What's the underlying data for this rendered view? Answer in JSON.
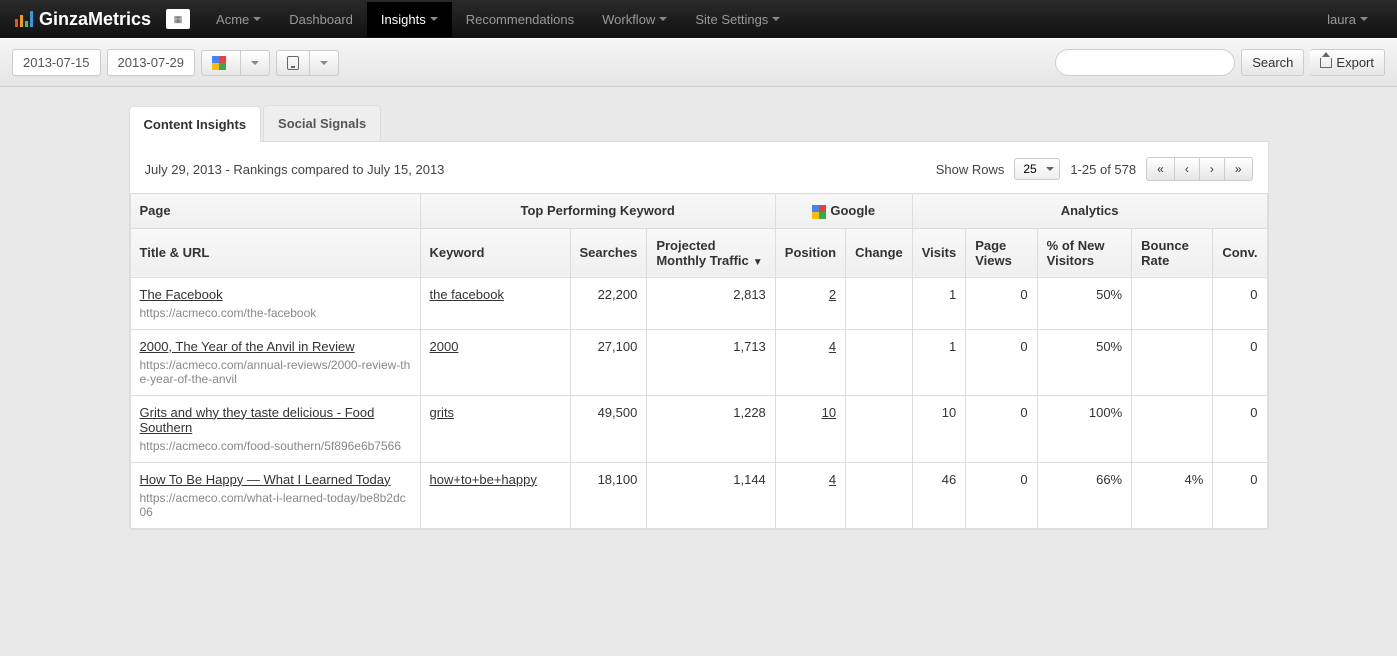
{
  "navbar": {
    "brand": "GinzaMetrics",
    "account": "Acme",
    "items": [
      "Dashboard",
      "Insights",
      "Recommendations",
      "Workflow",
      "Site Settings"
    ],
    "active_index": 1,
    "user": "laura"
  },
  "toolbar": {
    "date_start": "2013-07-15",
    "date_end": "2013-07-29",
    "search_label": "Search",
    "export_label": "Export"
  },
  "tabs": {
    "items": [
      "Content Insights",
      "Social Signals"
    ],
    "active_index": 0
  },
  "panel": {
    "summary": "July 29, 2013 - Rankings compared to July 15, 2013",
    "show_rows_label": "Show Rows",
    "show_rows_value": "25",
    "range_text": "1-25 of 578",
    "pager": {
      "first": "«",
      "prev": "‹",
      "next": "›",
      "last": "»"
    }
  },
  "table": {
    "group_headers": {
      "page": "Page",
      "keyword": "Top Performing Keyword",
      "google": "Google",
      "analytics": "Analytics"
    },
    "headers": {
      "title_url": "Title & URL",
      "keyword": "Keyword",
      "searches": "Searches",
      "traffic": "Projected Monthly Traffic",
      "position": "Position",
      "change": "Change",
      "visits": "Visits",
      "page_views": "Page Views",
      "new_visitors": "% of New Visitors",
      "bounce": "Bounce Rate",
      "conv": "Conv."
    },
    "sort_desc_indicator": "▼",
    "rows": [
      {
        "title": "The Facebook",
        "url": "https://acmeco.com/the-facebook",
        "keyword": "the facebook",
        "searches": "22,200",
        "traffic": "2,813",
        "position": "2",
        "change": "",
        "visits": "1",
        "page_views": "0",
        "new_visitors": "50%",
        "bounce": "",
        "conv": "0"
      },
      {
        "title": "2000, The Year of the Anvil in Review",
        "url": "https://acmeco.com/annual-reviews/2000-review-the-year-of-the-anvil",
        "keyword": "2000",
        "searches": "27,100",
        "traffic": "1,713",
        "position": "4",
        "change": "",
        "visits": "1",
        "page_views": "0",
        "new_visitors": "50%",
        "bounce": "",
        "conv": "0"
      },
      {
        "title": "Grits and why they taste delicious - Food Southern",
        "url": "https://acmeco.com/food-southern/5f896e6b7566",
        "keyword": "grits",
        "searches": "49,500",
        "traffic": "1,228",
        "position": "10",
        "change": "",
        "visits": "10",
        "page_views": "0",
        "new_visitors": "100%",
        "bounce": "",
        "conv": "0"
      },
      {
        "title": "How To Be Happy — What I Learned Today",
        "url": "https://acmeco.com/what-i-learned-today/be8b2dc06",
        "keyword": "how+to+be+happy",
        "searches": "18,100",
        "traffic": "1,144",
        "position": "4",
        "change": "",
        "visits": "46",
        "page_views": "0",
        "new_visitors": "66%",
        "bounce": "4%",
        "conv": "0"
      }
    ]
  }
}
